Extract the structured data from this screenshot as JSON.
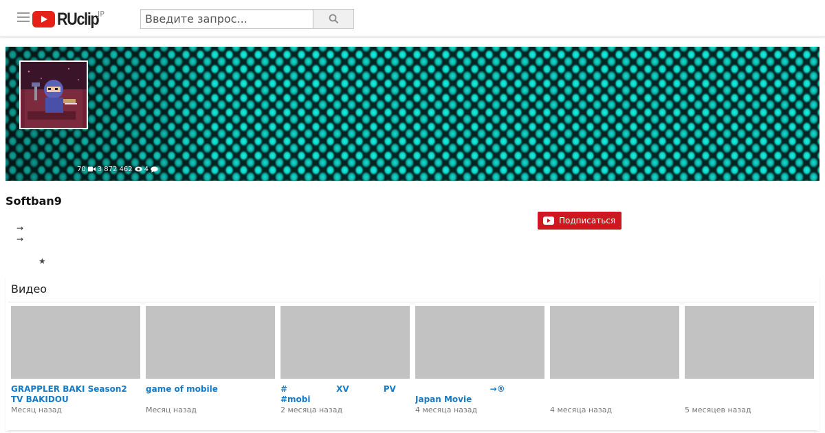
{
  "header": {
    "logo_text": "RUclip",
    "region": "JP",
    "search_placeholder": "Введите запрос...",
    "icons": {
      "menu": "hamburger-icon",
      "search": "search-icon",
      "logo": "play-icon"
    }
  },
  "banner": {
    "stats": {
      "videos": "70",
      "views": "3 872 462",
      "comments": "4"
    },
    "colors": {
      "dots": "#19f3e0",
      "background": "#052422"
    }
  },
  "channel": {
    "name": "Softban9",
    "subscribe_label": "Подписаться",
    "links": [
      "→",
      "→"
    ],
    "star": "★",
    "colors": {
      "subscribe": "#cc181e"
    }
  },
  "videos": {
    "heading": "Видео",
    "items": [
      {
        "title": "GRAPPLER BAKI Season2  TV BAKIDOU",
        "date": "Месяц назад"
      },
      {
        "title": "game of mobile",
        "date": "Месяц назад"
      },
      {
        "title": "#                 XV            PV #mobi",
        "date": "2 месяца назад"
      },
      {
        "title": "                          →®     Japan Movie",
        "date": "4 месяца назад"
      },
      {
        "title": "",
        "date": "4 месяца назад"
      },
      {
        "title": "",
        "date": "5 месяцев назад"
      }
    ],
    "colors": {
      "link": "#167ac6",
      "thumb": "#c2c2c2"
    }
  }
}
